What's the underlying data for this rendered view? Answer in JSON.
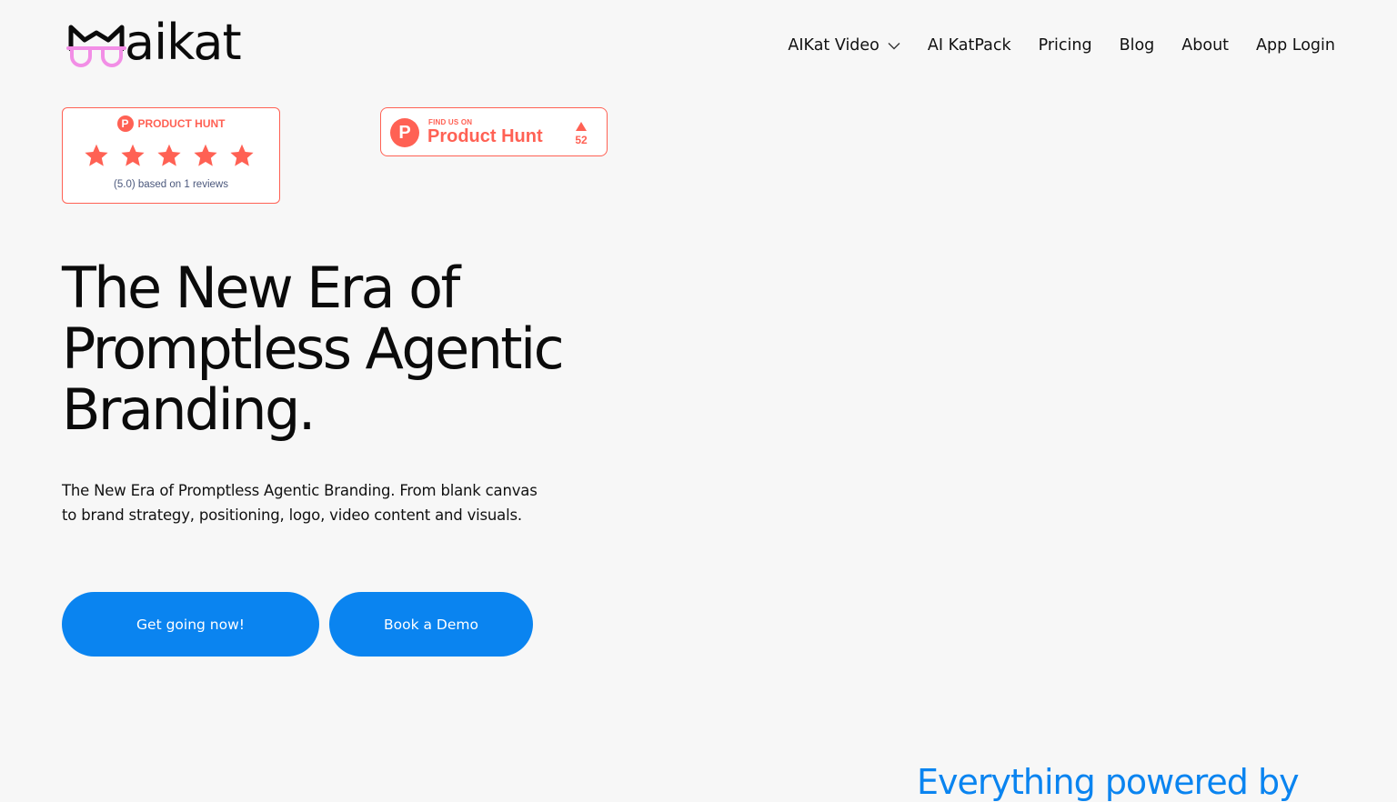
{
  "brand": {
    "logo_text": "aikat",
    "logo_icon": "cat-face-glasses-icon",
    "colors": {
      "accent": "#0a84f0",
      "logo_glasses": "#f28ee6",
      "product_hunt": "#ff6154"
    }
  },
  "nav": {
    "items": [
      {
        "label": "AIKat Video",
        "has_dropdown": true
      },
      {
        "label": "AI KatPack"
      },
      {
        "label": "Pricing"
      },
      {
        "label": "Blog"
      },
      {
        "label": "About"
      },
      {
        "label": "App Login"
      }
    ]
  },
  "product_hunt_rating": {
    "header": "PRODUCT HUNT",
    "icon_letter": "P",
    "rating": 5,
    "max_rating": 5,
    "caption": "(5.0) based on 1 reviews"
  },
  "product_hunt_badge": {
    "icon_letter": "P",
    "tagline": "FIND US ON",
    "name": "Product Hunt",
    "upvotes": "52"
  },
  "hero": {
    "title_lines": [
      "The New Era of",
      "Promptless Agentic",
      "Branding."
    ],
    "description": "The New Era of Promptless Agentic Branding. From blank canvas to brand strategy, positioning, logo, video content and visuals.",
    "primary_cta": "Get going now!",
    "secondary_cta": "Book a Demo"
  },
  "next_section": {
    "heading_partial": "Everything powered by"
  }
}
